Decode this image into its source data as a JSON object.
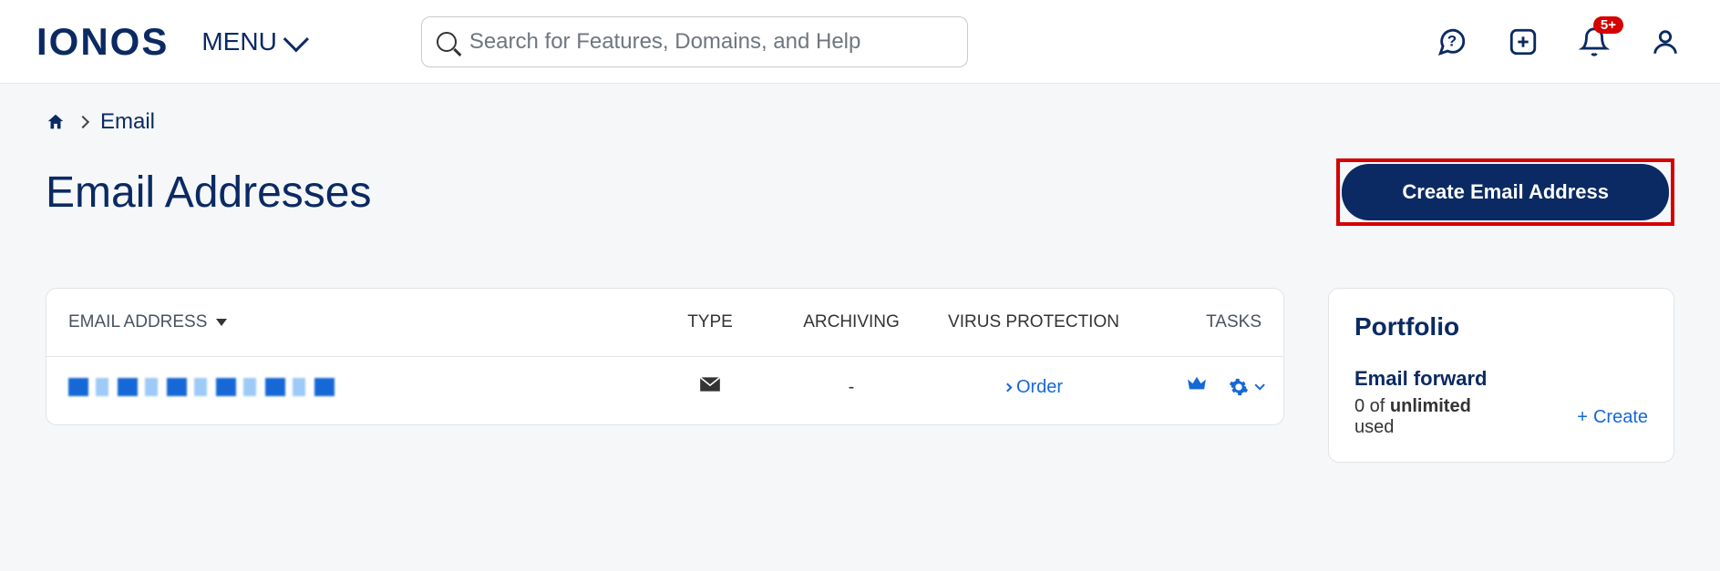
{
  "header": {
    "logo": "IONOS",
    "menu_label": "MENU",
    "search_placeholder": "Search for Features, Domains, and Help",
    "notification_badge": "5+"
  },
  "breadcrumb": {
    "current": "Email"
  },
  "page": {
    "title": "Email Addresses",
    "primary_button": "Create Email Address"
  },
  "table": {
    "columns": {
      "email": "EMAIL ADDRESS",
      "type": "TYPE",
      "archiving": "ARCHIVING",
      "virus": "VIRUS PROTECTION",
      "tasks": "TASKS"
    },
    "rows": [
      {
        "archiving": "-",
        "virus_action": "Order"
      }
    ]
  },
  "sidebar": {
    "title": "Portfolio",
    "forward": {
      "label": "Email forward",
      "used_prefix": "0 of ",
      "limit": "unlimited",
      "used_suffix": " used",
      "action": "Create"
    }
  }
}
